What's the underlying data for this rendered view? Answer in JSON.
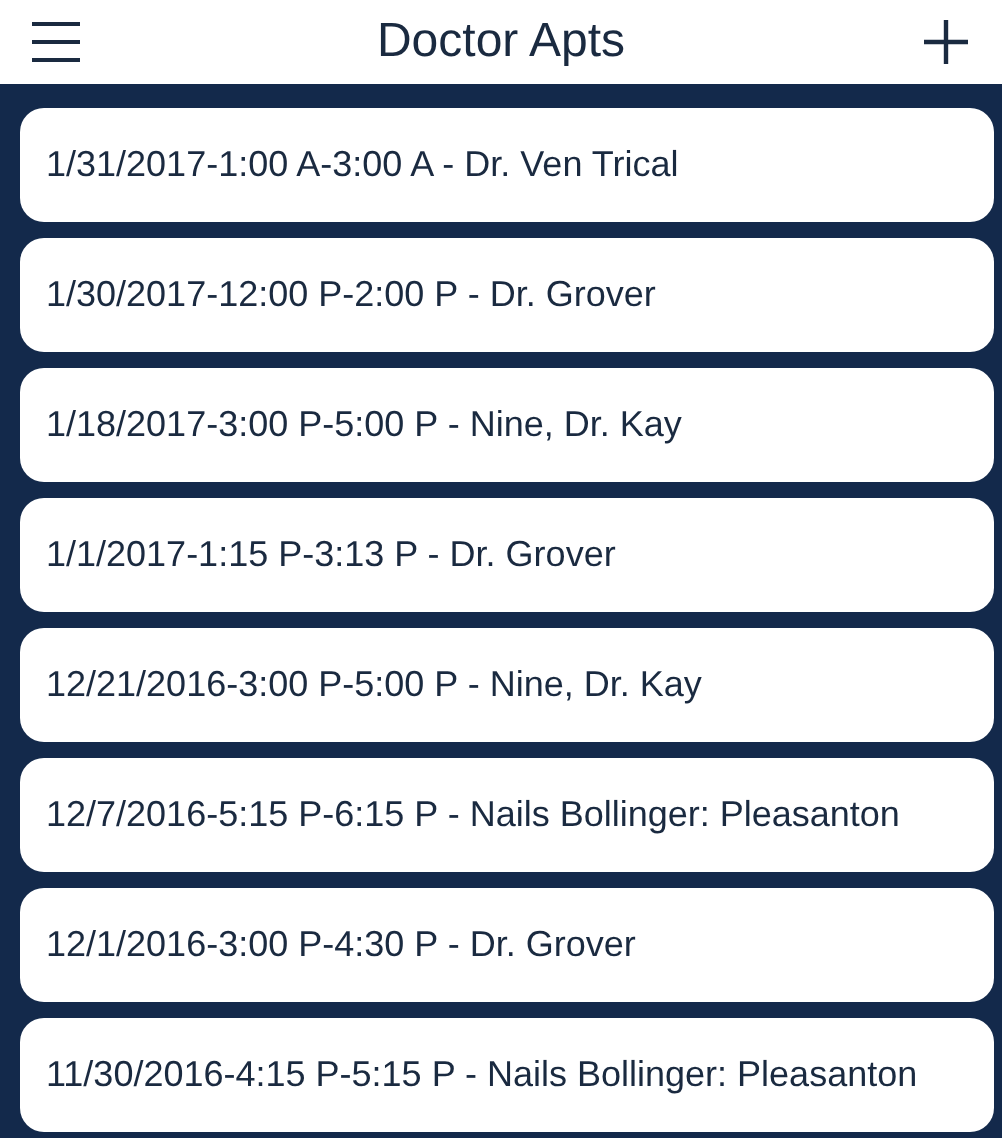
{
  "header": {
    "title": "Doctor Apts"
  },
  "appointments": [
    {
      "label": "1/31/2017-1:00 A-3:00 A - Dr. Ven Trical"
    },
    {
      "label": "1/30/2017-12:00 P-2:00 P - Dr. Grover"
    },
    {
      "label": "1/18/2017-3:00 P-5:00 P - Nine, Dr. Kay"
    },
    {
      "label": "1/1/2017-1:15 P-3:13 P - Dr. Grover"
    },
    {
      "label": "12/21/2016-3:00 P-5:00 P - Nine, Dr. Kay"
    },
    {
      "label": "12/7/2016-5:15 P-6:15 P - Nails Bollinger: Pleasanton"
    },
    {
      "label": "12/1/2016-3:00 P-4:30 P - Dr. Grover"
    },
    {
      "label": "11/30/2016-4:15 P-5:15 P - Nails Bollinger: Pleasanton"
    }
  ]
}
